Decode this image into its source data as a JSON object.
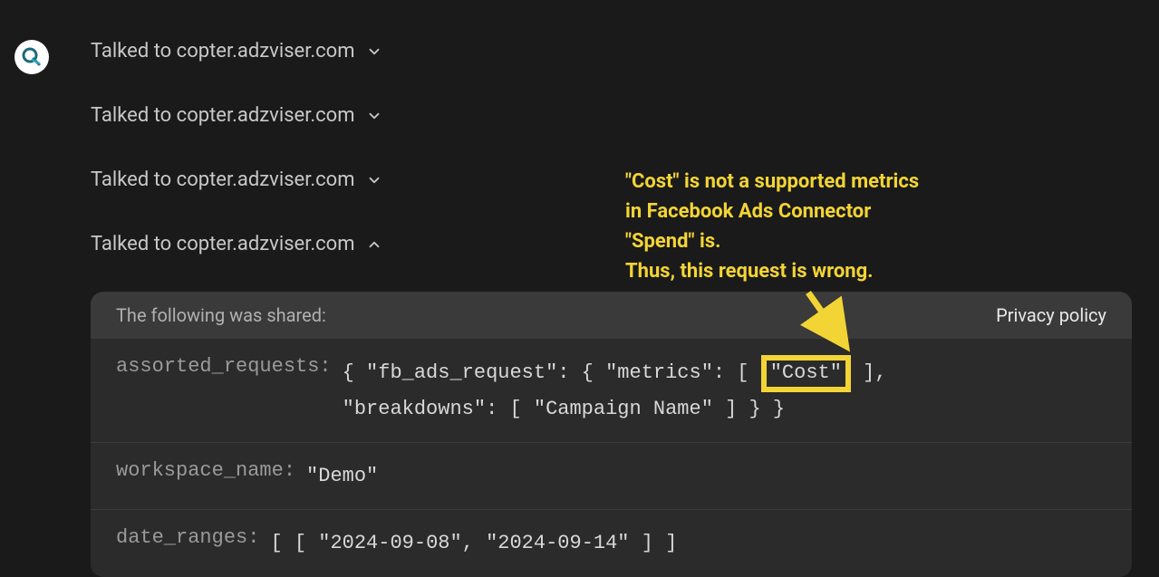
{
  "avatar": {
    "icon": "search-q"
  },
  "talked_rows": [
    {
      "label": "Talked to copter.adzviser.com",
      "expanded": false
    },
    {
      "label": "Talked to copter.adzviser.com",
      "expanded": false
    },
    {
      "label": "Talked to copter.adzviser.com",
      "expanded": false
    },
    {
      "label": "Talked to copter.adzviser.com",
      "expanded": true
    }
  ],
  "panel": {
    "header_label": "The following was shared:",
    "privacy_link": "Privacy policy",
    "rows": {
      "assorted_requests": {
        "key": "assorted_requests:",
        "prefix": "{ \"fb_ads_request\": { \"metrics\": [ ",
        "highlighted": "\"Cost\"",
        "suffix1": " ],",
        "line2": "\"breakdowns\": [ \"Campaign Name\" ] } }"
      },
      "workspace_name": {
        "key": "workspace_name:",
        "value": "\"Demo\""
      },
      "date_ranges": {
        "key": "date_ranges:",
        "value": "[ [ \"2024-09-08\", \"2024-09-14\" ] ]"
      }
    }
  },
  "annotation": {
    "line1": "\"Cost\" is not a supported metrics",
    "line2": "in Facebook Ads Connector",
    "line3": "\"Spend\" is.",
    "line4": "Thus, this request is wrong."
  }
}
